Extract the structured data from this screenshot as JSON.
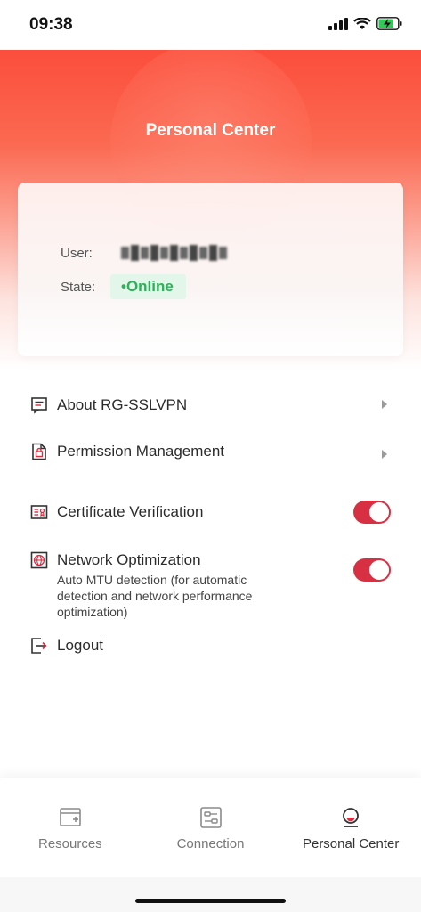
{
  "status_bar": {
    "time": "09:38"
  },
  "header": {
    "title": "Personal Center"
  },
  "user_card": {
    "user_label": "User:",
    "user_value": "liqiang1",
    "state_label": "State:",
    "state_value": "•Online"
  },
  "menu": {
    "about": "About RG-SSLVPN",
    "permission": "Permission Management",
    "certificate": "Certificate Verification",
    "certificate_enabled": true,
    "network": "Network Optimization",
    "network_desc": "Auto MTU detection (for automatic detection and network performance optimization)",
    "network_enabled": true,
    "logout": "Logout"
  },
  "nav": {
    "resources": "Resources",
    "connection": "Connection",
    "personal": "Personal Center",
    "active": "personal"
  },
  "colors": {
    "accent": "#d83043",
    "header": "#fb4e3c",
    "online": "#2fb05a"
  }
}
